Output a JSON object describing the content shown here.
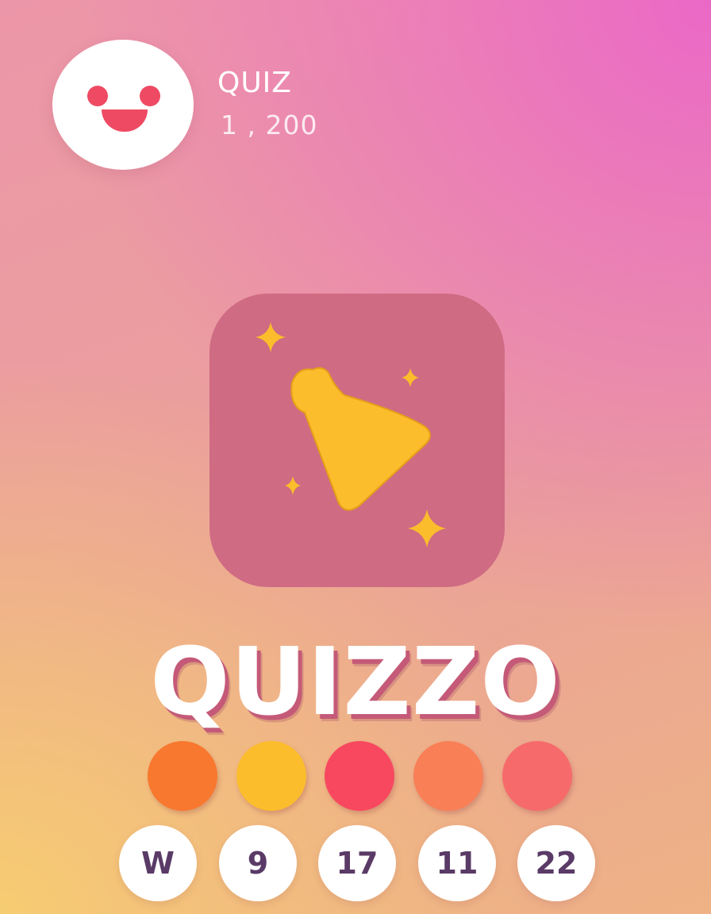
{
  "header": {
    "title": "QUIZ",
    "score": "1 , 200"
  },
  "app": {
    "name": "QUIZZO"
  },
  "icons": {
    "avatar": "smiley-face-icon",
    "app": "bell-sparkle-icon"
  },
  "colors": {
    "icon_background": "#cf6b83",
    "icon_glyph": "#fbbd2c",
    "smile": "#ef4a63",
    "text_dark": "#5a3a66"
  },
  "palette": [
    "#f8782f",
    "#fbbd2c",
    "#f84860",
    "#f97f57",
    "#f76a6c"
  ],
  "bubbles": [
    "W",
    "9",
    "17",
    "11",
    "22"
  ]
}
